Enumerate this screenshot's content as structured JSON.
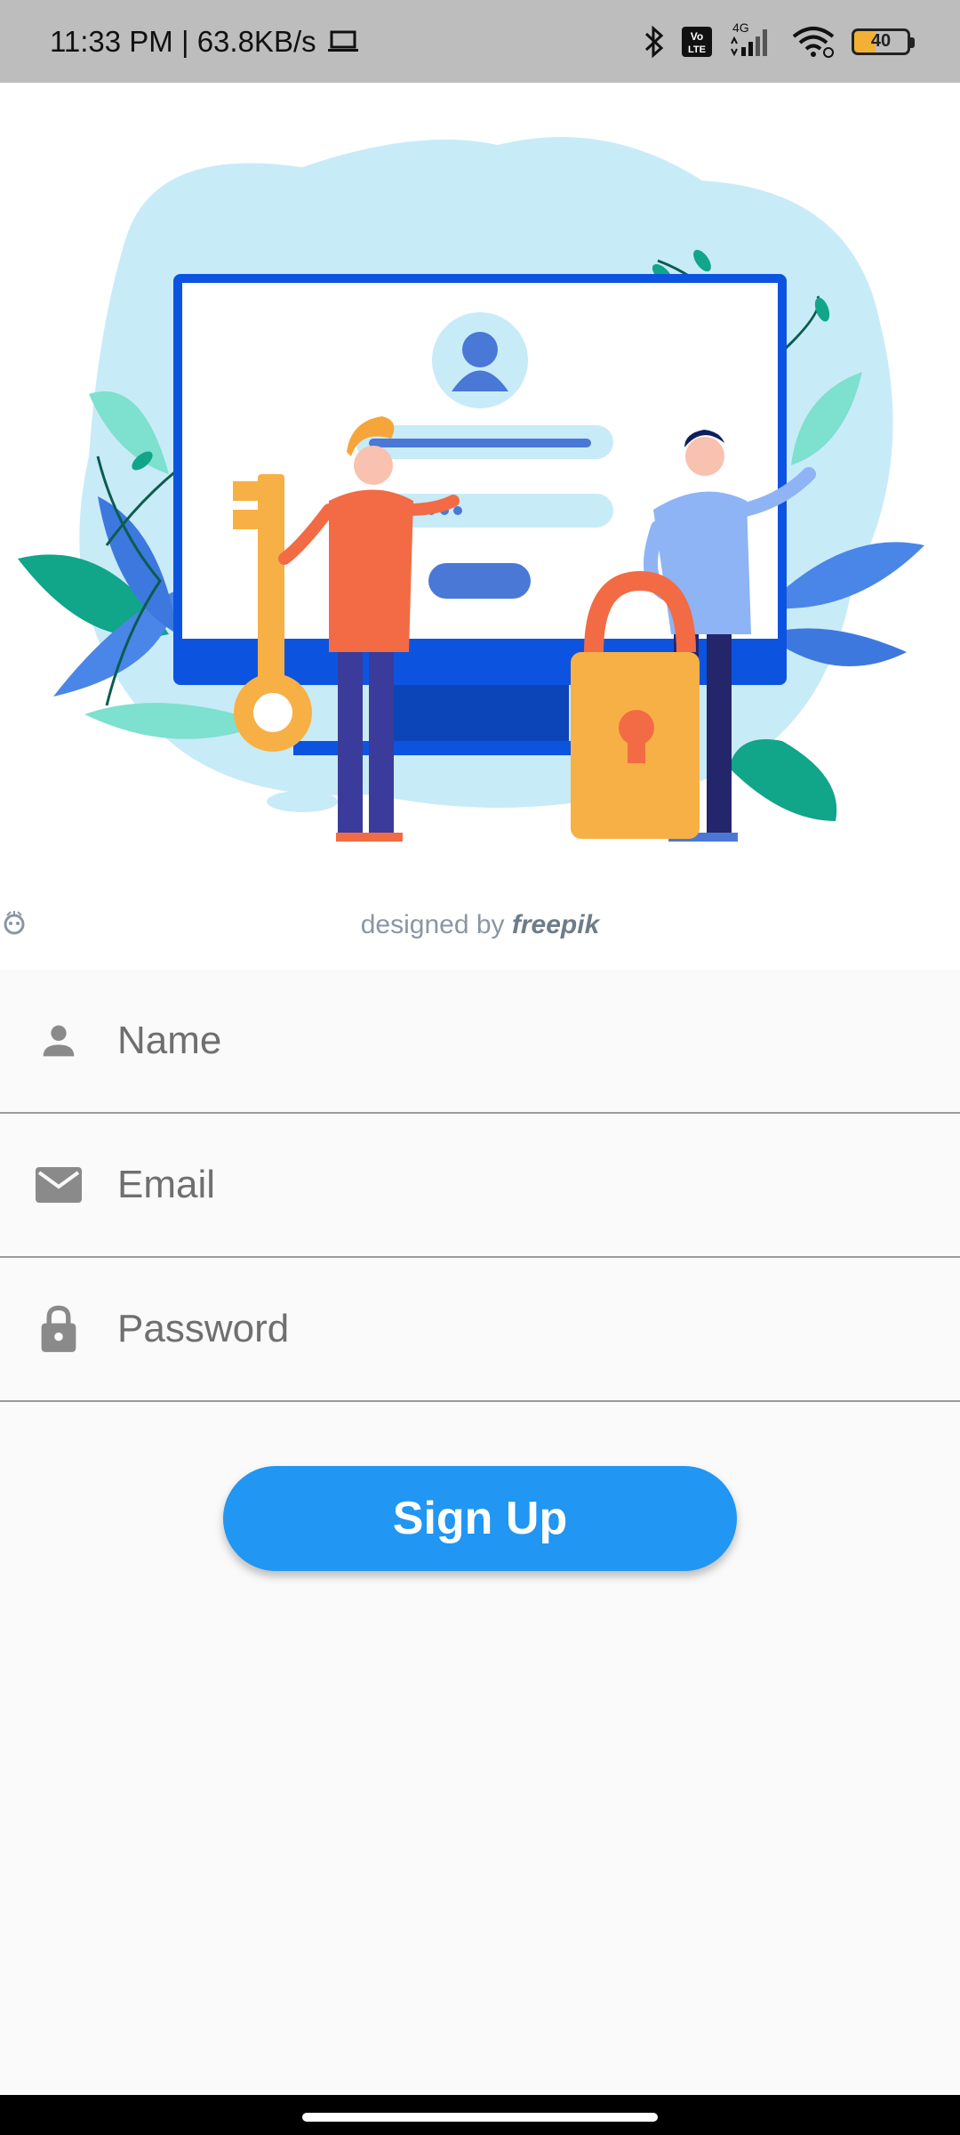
{
  "status_bar": {
    "time_speed": "11:33 PM | 63.8KB/s",
    "network_type": "4G",
    "volte": "Vo LTE",
    "battery_level": "40",
    "icons": [
      "laptop-icon",
      "bluetooth-icon",
      "volte-icon",
      "signal-icon",
      "wifi-icon",
      "battery-icon"
    ]
  },
  "hero": {
    "credit_prefix": "designed by",
    "credit_brand": "freepik"
  },
  "form": {
    "name": {
      "placeholder": "Name",
      "value": "",
      "icon": "person-icon"
    },
    "email": {
      "placeholder": "Email",
      "value": "",
      "icon": "mail-icon"
    },
    "password": {
      "placeholder": "Password",
      "value": "",
      "icon": "lock-icon"
    }
  },
  "signup": {
    "label": "Sign Up"
  },
  "colors": {
    "accent": "#2196f3",
    "status_bar": "#bdbdbd",
    "background": "#fafafa",
    "icon_gray": "#8a8a8a"
  }
}
